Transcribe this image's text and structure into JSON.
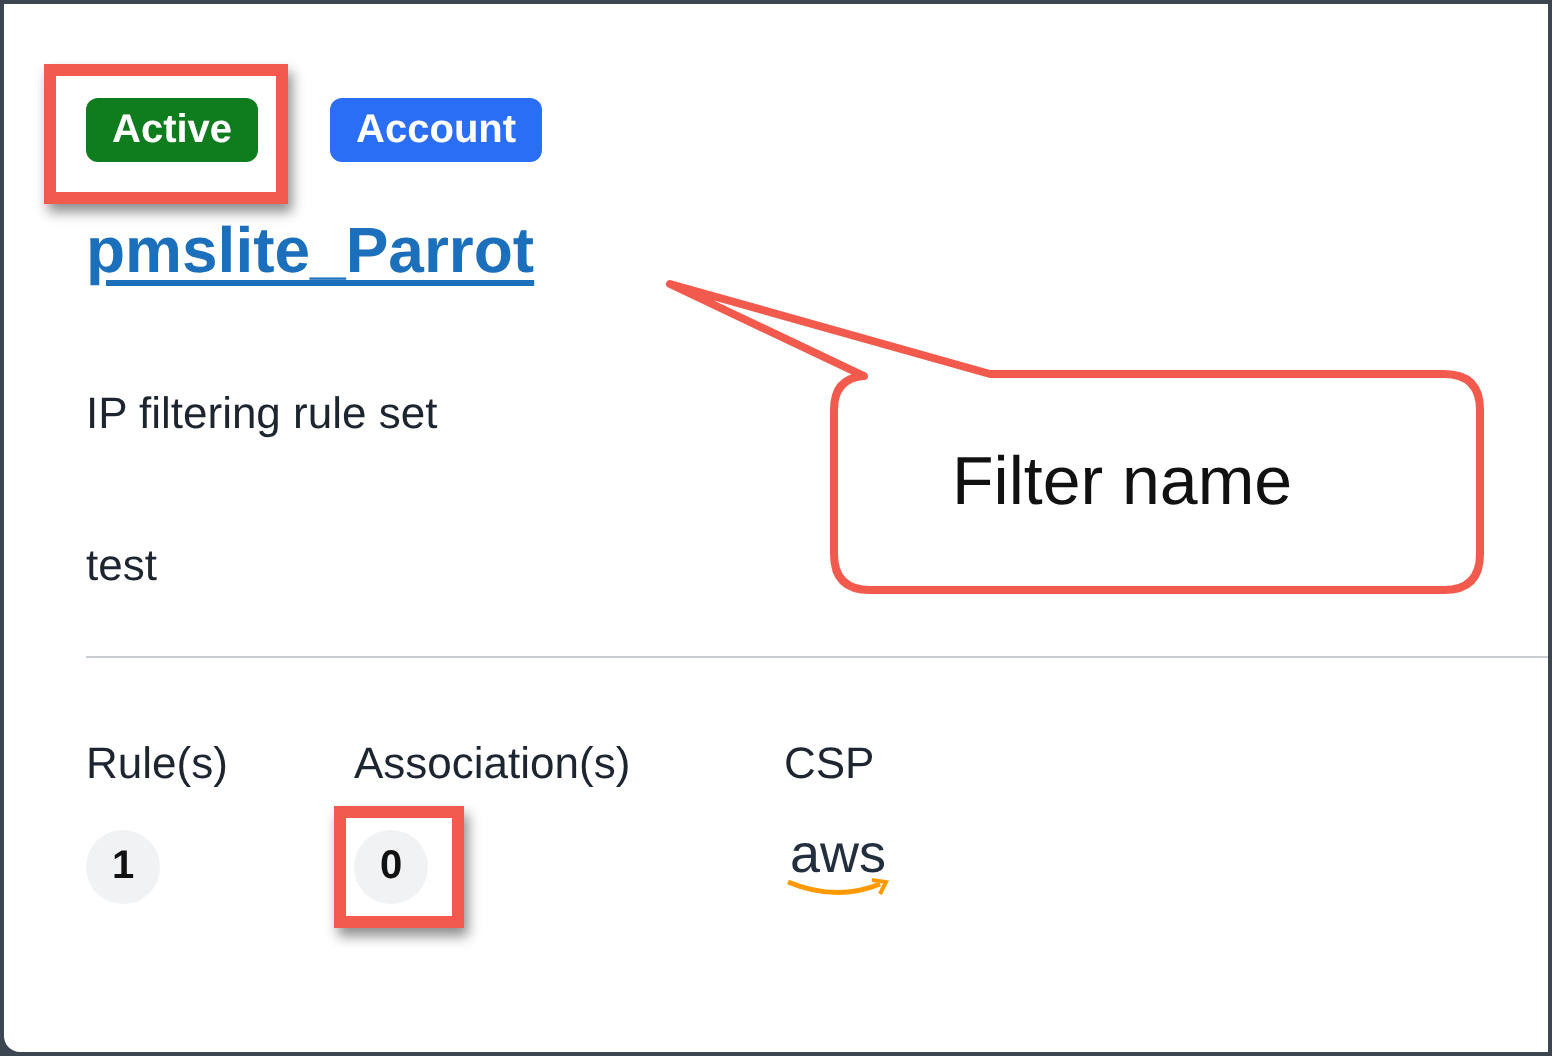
{
  "badges": [
    {
      "label": "Active",
      "color": "#0f7d1e",
      "highlighted": true
    },
    {
      "label": "Account",
      "color": "#2b6ef6",
      "highlighted": false
    }
  ],
  "title": "pmslite_Parrot",
  "description_label": "IP filtering rule set",
  "description": "test",
  "stats": [
    {
      "label": "Rule(s)",
      "value": "1",
      "kind": "count",
      "highlighted": false
    },
    {
      "label": "Association(s)",
      "value": "0",
      "kind": "count",
      "highlighted": true
    },
    {
      "label": "CSP",
      "value": "aws",
      "kind": "logo",
      "highlighted": false
    }
  ],
  "callout": {
    "text": "Filter name"
  }
}
